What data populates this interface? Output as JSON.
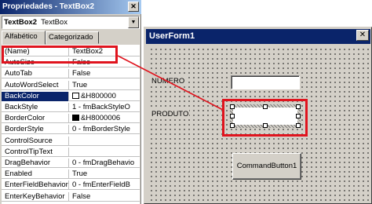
{
  "properties_window": {
    "title": "Propriedades - TextBox2",
    "object_name": "TextBox2",
    "object_type": "TextBox",
    "tabs": [
      "Alfabético",
      "Categorizado"
    ],
    "rows": [
      {
        "name": "(Name)",
        "value": "TextBox2"
      },
      {
        "name": "AutoSize",
        "value": "False"
      },
      {
        "name": "AutoTab",
        "value": "False"
      },
      {
        "name": "AutoWordSelect",
        "value": "True"
      },
      {
        "name": "BackColor",
        "value": "&H800000",
        "swatch": "#ffffff"
      },
      {
        "name": "BackStyle",
        "value": "1 - fmBackStyleO"
      },
      {
        "name": "BorderColor",
        "value": "&H8000006",
        "swatch": "#000000"
      },
      {
        "name": "BorderStyle",
        "value": "0 - fmBorderStyle"
      },
      {
        "name": "ControlSource",
        "value": ""
      },
      {
        "name": "ControlTipText",
        "value": ""
      },
      {
        "name": "DragBehavior",
        "value": "0 - fmDragBehavio"
      },
      {
        "name": "Enabled",
        "value": "True"
      },
      {
        "name": "EnterFieldBehavior",
        "value": "0 - fmEnterFieldB"
      },
      {
        "name": "EnterKeyBehavior",
        "value": "False"
      }
    ],
    "selected_row": "BackColor"
  },
  "userform": {
    "title": "UserForm1",
    "label_numero": "NUMERO",
    "label_produto": "PRODUTO",
    "button_label": "CommandButton1"
  },
  "colors": {
    "highlight": "#e0141e",
    "titlebar": "#0a246a",
    "face": "#d4d0c8"
  }
}
